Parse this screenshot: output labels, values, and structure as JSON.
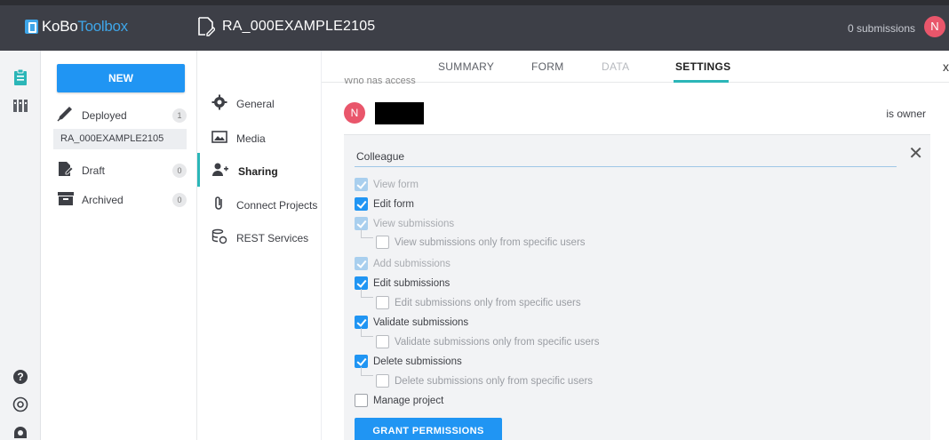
{
  "app": {
    "logo_text_a": "KoBo",
    "logo_text_b": "Toolbox",
    "project_title": "RA_000EXAMPLE2105",
    "submissions_count": "0 submissions",
    "user_initial": "N"
  },
  "sidebar": {
    "new_label": "NEW",
    "deployed": {
      "label": "Deployed",
      "count": "1"
    },
    "project_pill": "RA_000EXAMPLE2105",
    "draft": {
      "label": "Draft",
      "count": "0"
    },
    "archived": {
      "label": "Archived",
      "count": "0"
    }
  },
  "subnav": {
    "general": "General",
    "media": "Media",
    "sharing": "Sharing",
    "connect": "Connect Projects",
    "rest": "REST Services"
  },
  "tabs": {
    "summary": "SUMMARY",
    "form": "FORM",
    "data": "DATA",
    "settings": "SETTINGS",
    "close": "x"
  },
  "sharing": {
    "who_has_access": "Who has access",
    "owner_initial": "N",
    "is_owner": "is owner",
    "username_value": "Colleague",
    "close_icon": "✕",
    "permissions": {
      "view_form": "View form",
      "edit_form": "Edit form",
      "view_submissions": "View submissions",
      "view_submissions_specific": "View submissions only from specific users",
      "add_submissions": "Add submissions",
      "edit_submissions": "Edit submissions",
      "edit_submissions_specific": "Edit submissions only from specific users",
      "validate_submissions": "Validate submissions",
      "validate_submissions_specific": "Validate submissions only from specific users",
      "delete_submissions": "Delete submissions",
      "delete_submissions_specific": "Delete submissions only from specific users",
      "manage_project": "Manage project"
    },
    "grant_label": "GRANT PERMISSIONS"
  },
  "colors": {
    "topbar": "#3d3f47",
    "accent_blue": "#2095f3",
    "accent_teal": "#2bb6b8",
    "avatar": "#e9566b"
  }
}
